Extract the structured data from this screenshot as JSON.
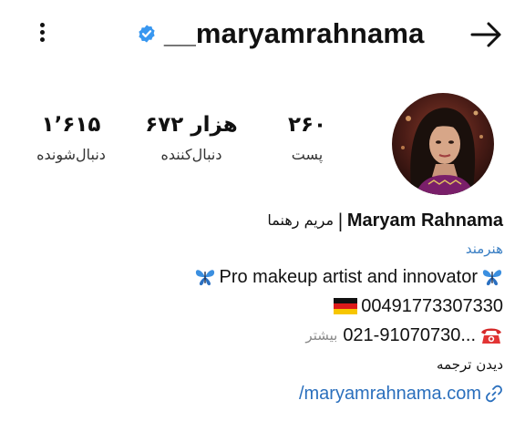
{
  "header": {
    "username": "__maryamrahnama",
    "menu_icon": "more-vertical-icon",
    "verified_icon": "verified-badge-icon",
    "forward_icon": "arrow-right-icon"
  },
  "stats": {
    "posts": {
      "count": "۲۶۰",
      "label": "پست"
    },
    "followers": {
      "count": "۶۷۲ هزار",
      "label": "دنبال‌کننده"
    },
    "following": {
      "count": "۱٬۶۱۵",
      "label": "دنبال‌شونده"
    }
  },
  "bio": {
    "name_en": "Maryam Rahnama",
    "separator": "|",
    "name_fa": "مریم رهنما",
    "category": "هنرمند",
    "tagline": "Pro makeup artist and innovator",
    "tagline_icon": "butterfly-icon",
    "phone_de": "00491773307330",
    "flag_icon": "germany-flag-icon",
    "phone_ir": "021-91070730...",
    "phone_icon": "telephone-icon",
    "more": "بیشتر",
    "translate": "دیدن ترجمه",
    "link": "/maryamrahnama.com",
    "link_icon": "link-icon"
  },
  "colors": {
    "verified": "#3897f0",
    "link": "#2a6fbd",
    "category": "#3a7fc4"
  }
}
